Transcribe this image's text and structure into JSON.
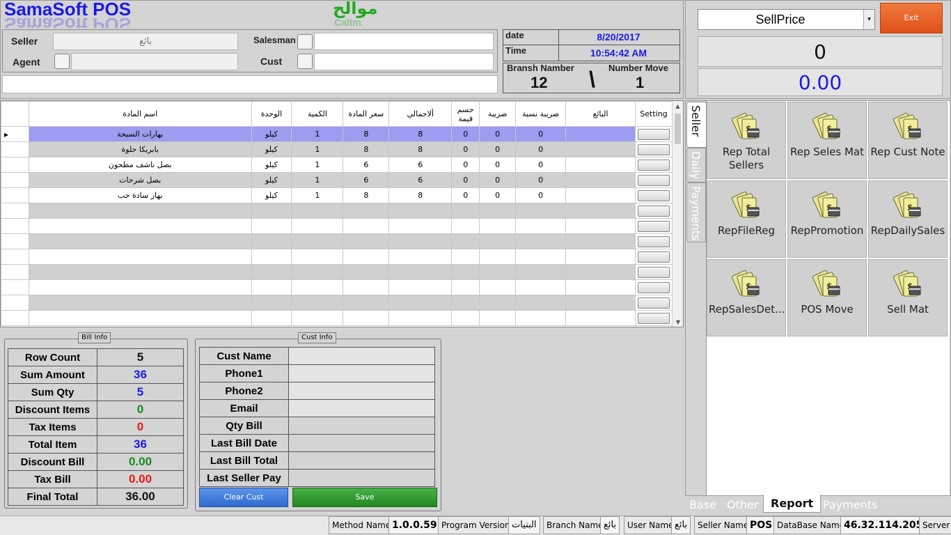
{
  "app": {
    "title": "SamaSoft POS",
    "title_reflection": "SamaSoft POS",
    "company": "موالح",
    "company_sub": "Caltm"
  },
  "header": {
    "seller_label": "Seller",
    "seller_value": "بائع",
    "agent_label": "Agent",
    "salesman_label": "Salesman",
    "cust_label": "Cust",
    "date_label": "date",
    "date_value": "8/20/2017",
    "time_label": "Time",
    "time_value": "10:54:42 AM",
    "branch_label": "Bransh Namber",
    "branch_value": "12",
    "sep": "\\",
    "number_move_label": "Number Move",
    "number_move_value": "1"
  },
  "price_panel": {
    "select_value": "SellPrice",
    "exit_label": "Exit",
    "qty_display": "0",
    "amount_display": "0.00"
  },
  "grid": {
    "headers": {
      "name": "اسم المادة",
      "unit": "الوحدة",
      "qty": "الكمية",
      "price": "سعر المادة",
      "total": "ألاجمالي",
      "disc": "حسم قيمة",
      "tax": "ضريبة",
      "tax_pct": "ضريبة نسبة",
      "seller": "البائع",
      "setting": "Setting"
    },
    "rows": [
      {
        "name": "بهارات السبحة",
        "unit": "كيلو",
        "qty": "1",
        "price": "8",
        "total": "8",
        "disc": "0",
        "tax": "0",
        "tax_pct": "0"
      },
      {
        "name": "بابريكا حلوة",
        "unit": "كيلو",
        "qty": "1",
        "price": "8",
        "total": "8",
        "disc": "0",
        "tax": "0",
        "tax_pct": "0"
      },
      {
        "name": "بصل ناشف مطحون",
        "unit": "كيلو",
        "qty": "1",
        "price": "6",
        "total": "6",
        "disc": "0",
        "tax": "0",
        "tax_pct": "0"
      },
      {
        "name": "بصل شرحات",
        "unit": "كيلو",
        "qty": "1",
        "price": "6",
        "total": "6",
        "disc": "0",
        "tax": "0",
        "tax_pct": "0"
      },
      {
        "name": "بهار سادة حب",
        "unit": "كيلو",
        "qty": "1",
        "price": "8",
        "total": "8",
        "disc": "0",
        "tax": "0",
        "tax_pct": "0"
      }
    ]
  },
  "bill_info": {
    "legend": "Bill Info",
    "rows": [
      {
        "label": "Row Count",
        "value": "5",
        "color": "#111111"
      },
      {
        "label": "Sum Amount",
        "value": "36",
        "color": "#1a1ae6"
      },
      {
        "label": "Sum Qty",
        "value": "5",
        "color": "#1a1ae6"
      },
      {
        "label": "Discount Items",
        "value": "0",
        "color": "#1a8a1a"
      },
      {
        "label": "Tax Items",
        "value": "0",
        "color": "#e61a1a"
      },
      {
        "label": "Total Item",
        "value": "36",
        "color": "#1a1ae6"
      },
      {
        "label": "Discount Bill",
        "value": "0.00",
        "color": "#1a8a1a"
      },
      {
        "label": "Tax Bill",
        "value": "0.00",
        "color": "#e61a1a"
      },
      {
        "label": "Final Total",
        "value": "36.00",
        "color": "#111111"
      }
    ]
  },
  "cust_info": {
    "legend": "Cust Info",
    "fields": [
      "Cust Name",
      "Phone1",
      "Phone2",
      "Email",
      "Qty Bill",
      "Last Bill Date",
      "Last Bill Total",
      "Last Seller Pay"
    ],
    "clear_label": "Clear Cust",
    "save_label": "Save"
  },
  "side_tabs": [
    "Seller",
    "Daily",
    "Payments"
  ],
  "reports": [
    "Rep Total Sellers",
    "Rep Seles Mat",
    "Rep Cust Note",
    "RepFileReg",
    "RepPromotion",
    "RepDailySales",
    "RepSalesDet...",
    "POS Move",
    "Sell Mat"
  ],
  "bottom_tabs": [
    "Base",
    "Other",
    "Report",
    "Payments"
  ],
  "status": {
    "method_label": "Method Name",
    "version": "1.0.0.59",
    "version_label": "Program Version",
    "branch_value": "البنيات",
    "branch_label": "Branch Name",
    "user_value": "بائع",
    "user_label": "User Name",
    "seller_value": "بائع",
    "seller_label": "Seller Name",
    "db_value": "POS",
    "db_label": "DataBase Name",
    "server_value": "46.32.114.205",
    "server_label": "Server"
  },
  "colors": {
    "title": "#1a1ae6",
    "company": "#22aa22",
    "exit": "#e85a1c",
    "selected_row": "#9c9cf0",
    "clear_btn": "#3a78d8",
    "save_btn": "#2e9a2e",
    "blue_text": "#1a1ae6"
  }
}
